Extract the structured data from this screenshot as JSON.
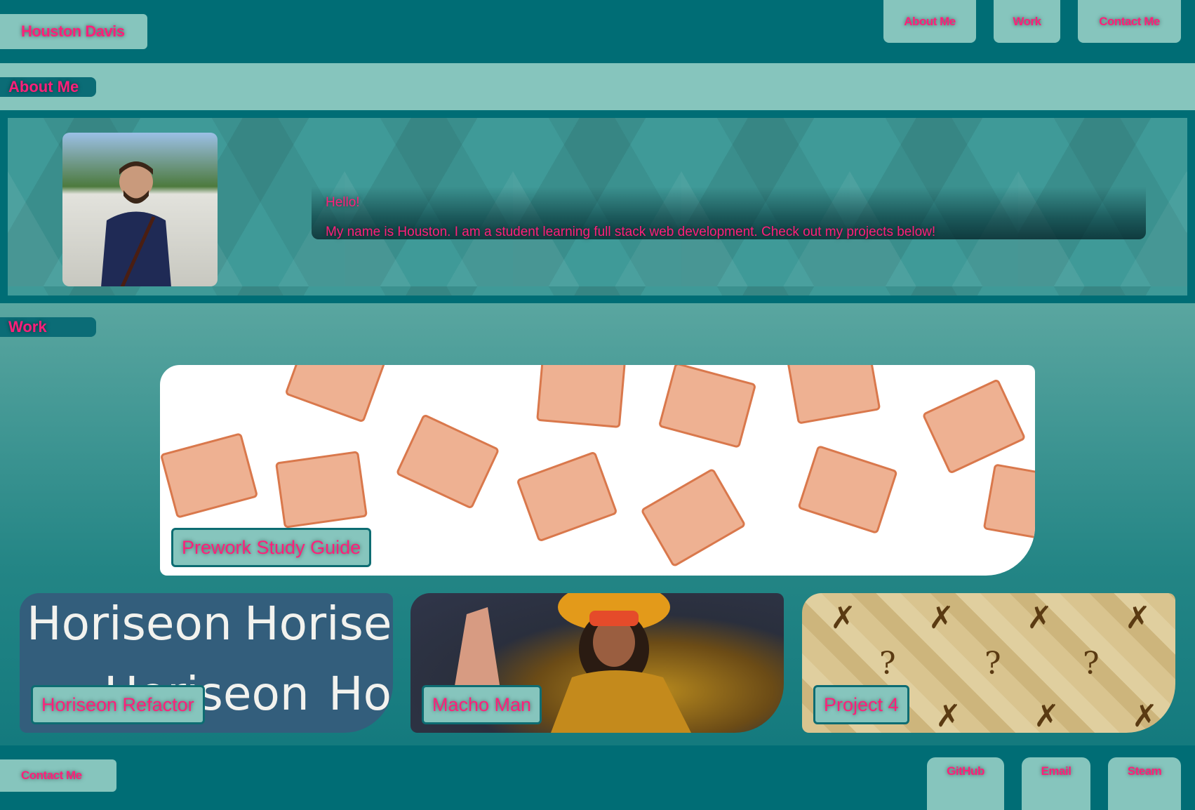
{
  "header": {
    "brand": "Houston Davis",
    "nav": [
      {
        "label": "About Me"
      },
      {
        "label": "Work"
      },
      {
        "label": "Contact Me"
      }
    ]
  },
  "about": {
    "heading": "About Me",
    "greeting": "Hello!",
    "bio": "My name is Houston. I am a student learning full stack web development. Check out my projects below!",
    "photo_alt": "portrait-photo"
  },
  "work": {
    "heading": "Work",
    "projects": [
      {
        "title": "Prework Study Guide",
        "image": "books-pattern"
      },
      {
        "title": "Horiseon Refactor",
        "image": "horiseon-logo-pattern",
        "image_text": "Horiseon"
      },
      {
        "title": "Macho Man",
        "image": "wrestler-photo"
      },
      {
        "title": "Project 4",
        "image": "checkmark-question-pattern"
      }
    ]
  },
  "footer": {
    "contact": "Contact Me",
    "links": [
      {
        "label": "GitHub"
      },
      {
        "label": "Email"
      },
      {
        "label": "Steam"
      }
    ]
  },
  "colors": {
    "primary": "#006d75",
    "light": "#86c5bd",
    "accent": "#ff1f7a"
  }
}
